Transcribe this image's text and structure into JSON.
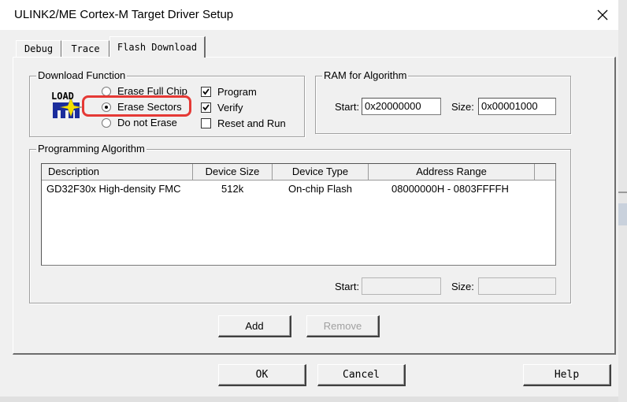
{
  "window": {
    "title": "ULINK2/ME Cortex-M Target Driver Setup"
  },
  "tabs": [
    {
      "label": "Debug"
    },
    {
      "label": "Trace"
    },
    {
      "label": "Flash Download"
    }
  ],
  "download_function": {
    "legend": "Download Function",
    "icon_text": "LOAD",
    "radios": [
      {
        "label": "Erase Full Chip",
        "checked": false
      },
      {
        "label": "Erase Sectors",
        "checked": true
      },
      {
        "label": "Do not Erase",
        "checked": false
      }
    ],
    "checkboxes": [
      {
        "label": "Program",
        "checked": true
      },
      {
        "label": "Verify",
        "checked": true
      },
      {
        "label": "Reset and Run",
        "checked": false
      }
    ]
  },
  "ram": {
    "legend": "RAM for Algorithm",
    "start_label": "Start:",
    "start_value": "0x20000000",
    "size_label": "Size:",
    "size_value": "0x00001000"
  },
  "programming": {
    "legend": "Programming Algorithm",
    "columns": [
      "Description",
      "Device Size",
      "Device Type",
      "Address Range"
    ],
    "rows": [
      [
        "GD32F30x High-density FMC",
        "512k",
        "On-chip Flash",
        "08000000H - 0803FFFFH"
      ]
    ],
    "start_label": "Start:",
    "start_value": "",
    "size_label": "Size:",
    "size_value": ""
  },
  "buttons": {
    "add": "Add",
    "remove": "Remove",
    "ok": "OK",
    "cancel": "Cancel",
    "help": "Help"
  },
  "colors": {
    "highlight": "#e53935"
  }
}
